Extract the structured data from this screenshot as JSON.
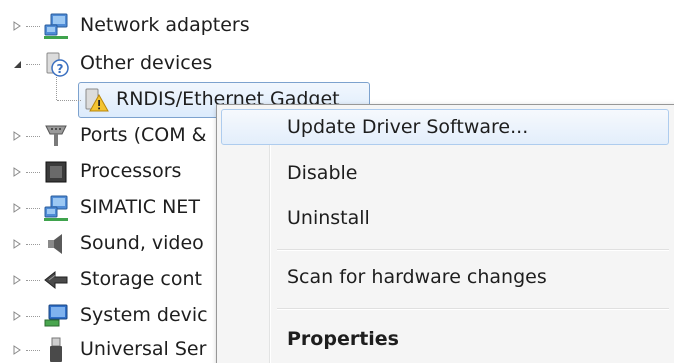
{
  "tree": {
    "items": [
      {
        "label": "Network adapters",
        "icon": "network-adapter-icon",
        "expander": "collapsed"
      },
      {
        "label": "Other devices",
        "icon": "unknown-device-icon",
        "expander": "expanded"
      },
      {
        "label": "RNDIS/Ethernet Gadget",
        "icon": "warning-device-icon",
        "child": true,
        "selected": true
      },
      {
        "label": "Ports (COM &",
        "icon": "port-icon",
        "expander": "collapsed"
      },
      {
        "label": "Processors",
        "icon": "processor-icon",
        "expander": "collapsed"
      },
      {
        "label": "SIMATIC NET",
        "icon": "network-adapter-icon",
        "expander": "collapsed"
      },
      {
        "label": "Sound, video",
        "icon": "speaker-icon",
        "expander": "collapsed"
      },
      {
        "label": "Storage cont",
        "icon": "storage-controller-icon",
        "expander": "collapsed"
      },
      {
        "label": "System devic",
        "icon": "system-device-icon",
        "expander": "collapsed"
      },
      {
        "label": "Universal Ser",
        "icon": "usb-icon",
        "expander": "collapsed"
      }
    ]
  },
  "context_menu": {
    "items": [
      {
        "label": "Update Driver Software...",
        "highlighted": true
      },
      {
        "label": "Disable"
      },
      {
        "label": "Uninstall"
      },
      {
        "label": "Scan for hardware changes"
      },
      {
        "label": "Properties",
        "bold": true
      }
    ]
  },
  "colors": {
    "selection_border": "#7da2ce",
    "menu_background": "#f5f5f5",
    "menu_hover_border": "#aeccee"
  }
}
